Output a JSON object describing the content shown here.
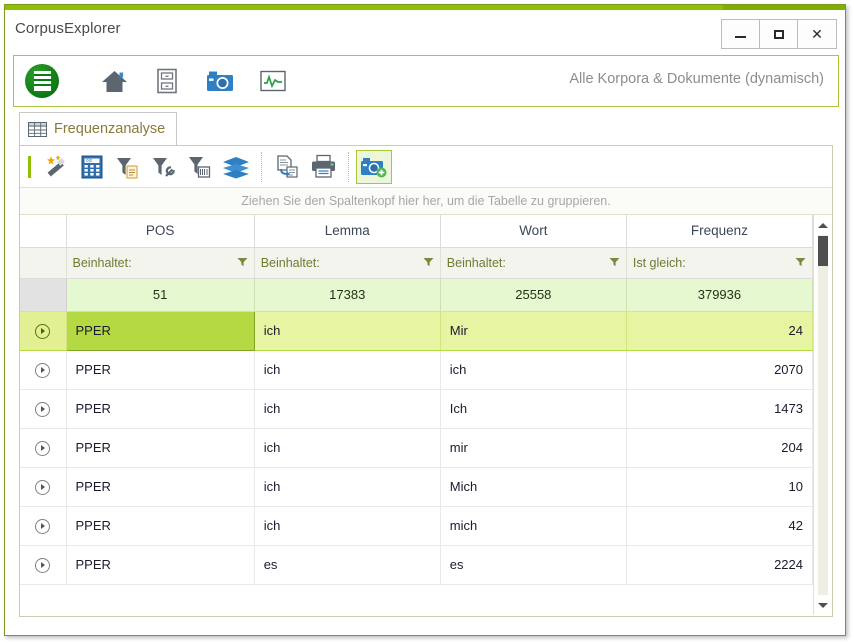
{
  "window": {
    "app_title": "CorpusExplorer",
    "controls": {
      "minimize": "minimize-button",
      "maximize": "maximize-button",
      "close": "close-button"
    }
  },
  "navstrip": {
    "logo_name": "corpusexplorer-logo",
    "icons": [
      {
        "name": "home-icon",
        "label": "Home"
      },
      {
        "name": "archive-drawer-icon",
        "label": "Archiv"
      },
      {
        "name": "camera-icon",
        "label": "Snapshot"
      },
      {
        "name": "chart-monitor-icon",
        "label": "Analyse"
      }
    ],
    "corpus_label": "Alle Korpora & Dokumente (dynamisch)"
  },
  "tab": {
    "label": "Frequenzanalyse",
    "icon": "table-grid-icon"
  },
  "toolbar": {
    "buttons": [
      {
        "name": "magic-wand-icon",
        "label": "Auto"
      },
      {
        "name": "calculator-icon",
        "label": "Berechnen"
      },
      {
        "name": "filter-clipboard-icon",
        "label": "Filter einfügen"
      },
      {
        "name": "filter-wrench-icon",
        "label": "Filter bearbeiten"
      },
      {
        "name": "filter-save-icon",
        "label": "Filter speichern"
      },
      {
        "name": "layers-icon",
        "label": "Ebenen"
      },
      {
        "name": "export-document-icon",
        "label": "Export"
      },
      {
        "name": "printer-icon",
        "label": "Drucken"
      },
      {
        "name": "camera-add-icon",
        "label": "Snapshot erstellen"
      }
    ]
  },
  "grid": {
    "group_hint": "Ziehen Sie den Spaltenkopf hier her, um die Tabelle zu gruppieren.",
    "columns": [
      "POS",
      "Lemma",
      "Wort",
      "Frequenz"
    ],
    "filters": [
      "Beinhaltet:",
      "Beinhaltet:",
      "Beinhaltet:",
      "Ist gleich:"
    ],
    "summary": [
      "51",
      "17383",
      "25558",
      "379936"
    ],
    "rows": [
      {
        "pos": "PPER",
        "lemma": "ich",
        "wort": "Mir",
        "frequenz": "24",
        "selected": true
      },
      {
        "pos": "PPER",
        "lemma": "ich",
        "wort": "ich",
        "frequenz": "2070",
        "selected": false
      },
      {
        "pos": "PPER",
        "lemma": "ich",
        "wort": "Ich",
        "frequenz": "1473",
        "selected": false
      },
      {
        "pos": "PPER",
        "lemma": "ich",
        "wort": "mir",
        "frequenz": "204",
        "selected": false
      },
      {
        "pos": "PPER",
        "lemma": "ich",
        "wort": "Mich",
        "frequenz": "10",
        "selected": false
      },
      {
        "pos": "PPER",
        "lemma": "ich",
        "wort": "mich",
        "frequenz": "42",
        "selected": false
      },
      {
        "pos": "PPER",
        "lemma": "es",
        "wort": "es",
        "frequenz": "2224",
        "selected": false
      }
    ]
  },
  "colors": {
    "accent_green": "#8fc002",
    "accent_green_dark": "#7fae00",
    "panel_border": "#c9cfae",
    "summary_bg": "#e6f8cf",
    "selection_bg": "#e7f4a1",
    "focus_cell_bg": "#b5d943",
    "filter_text": "#6f7a30"
  }
}
